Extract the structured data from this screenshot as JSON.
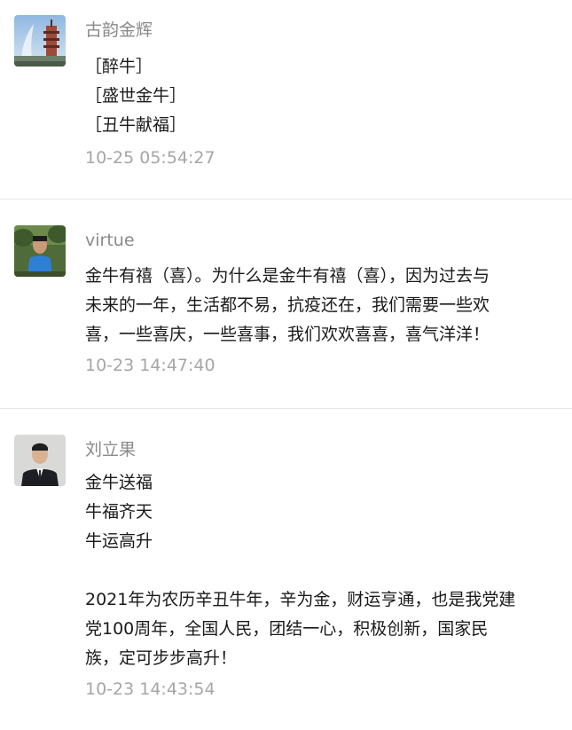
{
  "comments": [
    {
      "name": "古韵金辉",
      "lines": [
        "［醉牛］",
        "［盛世金牛］",
        "［丑牛献福］"
      ],
      "time": "10-25 05:54:27"
    },
    {
      "name": "virtue",
      "lines": [
        "金牛有禧（喜）。为什么是金牛有禧（喜），因为过去与",
        "未来的一年，生活都不易，抗疫还在，我们需要一些欢",
        "喜，一些喜庆，一些喜事，我们欢欢喜喜，喜气洋洋！"
      ],
      "time": "10-23 14:47:40"
    },
    {
      "name": "刘立果",
      "lines": [
        "金牛送福",
        "牛福齐天",
        "牛运高升",
        "",
        "2021年为农历辛丑牛年，辛为金，财运亨通，也是我党建",
        "党100周年，全国人民，团结一心，积极创新，国家民",
        "族，定可步步高升！"
      ],
      "time": "10-23 14:43:54"
    }
  ]
}
